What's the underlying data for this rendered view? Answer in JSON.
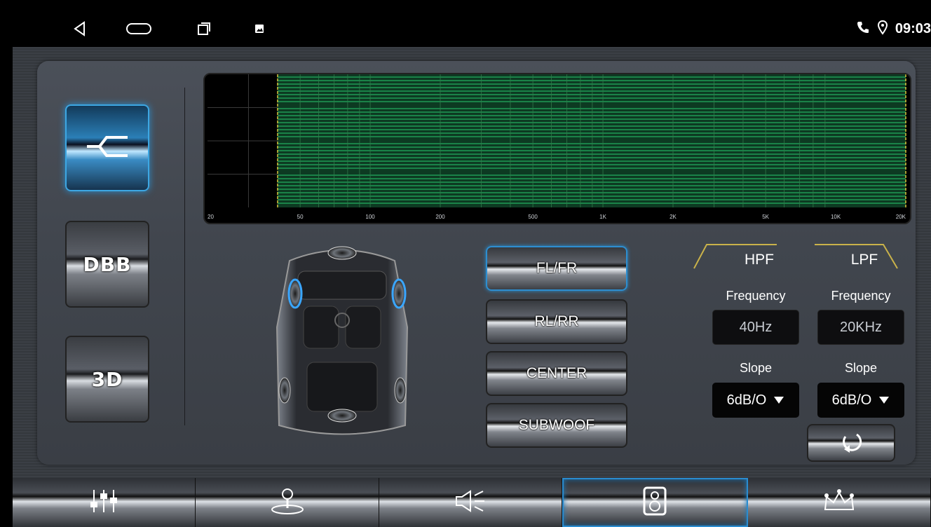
{
  "statusbar": {
    "nav_icons": [
      "back-icon",
      "home-icon",
      "recents-icon",
      "image-notification-icon"
    ],
    "status_icons": [
      "phone-icon",
      "location-icon"
    ],
    "time": "09:03"
  },
  "modes": [
    {
      "name": "crossover",
      "label": "",
      "icon": "crossover-icon",
      "active": true
    },
    {
      "name": "dbb",
      "label": "DBB",
      "active": false
    },
    {
      "name": "3d",
      "label": "3D",
      "active": false
    }
  ],
  "chart_data": {
    "type": "line",
    "x_ticks": [
      "20",
      "50",
      "100",
      "200",
      "500",
      "1K",
      "2K",
      "5K",
      "10K",
      "20K"
    ],
    "xscale": "log",
    "passband": {
      "low_hz": 40,
      "high_hz": 20000
    },
    "colors": {
      "band": "#1f9a55",
      "edge": "#d9c33a",
      "grid": "#3a3a3a"
    }
  },
  "channels": [
    {
      "label": "FL/FR",
      "active": true
    },
    {
      "label": "RL/RR",
      "active": false
    },
    {
      "label": "CENTER",
      "active": false
    },
    {
      "label": "SUBWOOF",
      "active": false
    }
  ],
  "filters": {
    "hpf": {
      "title": "HPF",
      "freq_label": "Frequency",
      "freq_value": "40Hz",
      "slope_label": "Slope",
      "slope_value": "6dB/O"
    },
    "lpf": {
      "title": "LPF",
      "freq_label": "Frequency",
      "freq_value": "20KHz",
      "slope_label": "Slope",
      "slope_value": "6dB/O"
    }
  },
  "tabs": [
    {
      "icon": "equalizer-icon",
      "active": false
    },
    {
      "icon": "joystick-balance-icon",
      "active": false
    },
    {
      "icon": "volume-icon",
      "active": false
    },
    {
      "icon": "speaker-icon",
      "active": true
    },
    {
      "icon": "crown-icon",
      "active": false
    }
  ],
  "colors": {
    "accent": "#2b8fd0",
    "gold": "#c9b24a"
  }
}
